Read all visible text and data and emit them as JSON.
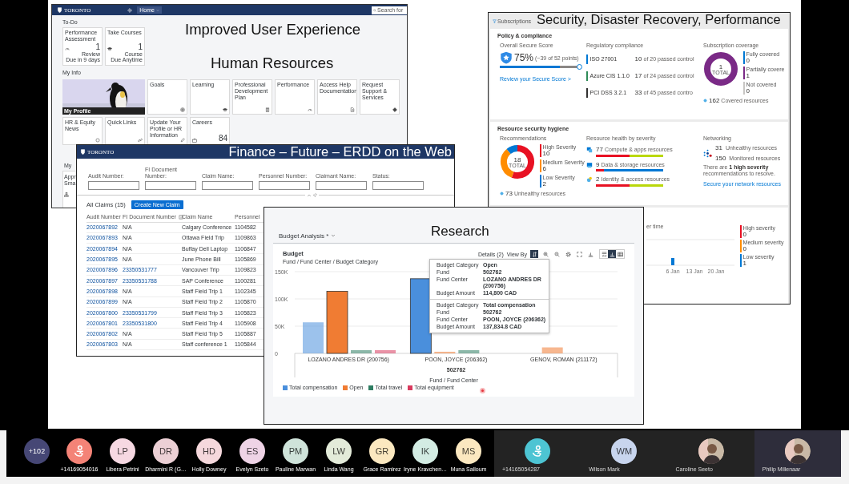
{
  "hr_portal": {
    "logo": "TORONTO",
    "nav": "Home",
    "search_placeholder": "Search for",
    "slide_title": "Improved User Experience",
    "slide_subtitle": "Human Resources",
    "todo_label": "To-Do",
    "todo_tiles": [
      {
        "title": "Performance Assessment",
        "kind": "gauge",
        "count": "1",
        "caption": "Review",
        "subcaption": "Due in 9 days"
      },
      {
        "title": "Take Courses",
        "kind": "cap",
        "count": "1",
        "caption": "Course",
        "subcaption": "Due Anytime"
      }
    ],
    "myinfo_label": "My Info",
    "profile_caption": "My Profile",
    "info_tiles": [
      {
        "title": "Goals",
        "kind": "target"
      },
      {
        "title": "Learning",
        "kind": "cap"
      },
      {
        "title": "Professional Development Plan",
        "kind": "clipboard"
      },
      {
        "title": "Performance",
        "kind": "gauge"
      },
      {
        "title": "Access Help Documentation",
        "kind": "doc"
      },
      {
        "title": "Request Support & Services",
        "kind": "diamond"
      }
    ],
    "row2_tiles": [
      {
        "title": "HR & Equity News",
        "kind": "ring"
      },
      {
        "title": "Quick Links",
        "kind": "link"
      },
      {
        "title": "Update Your Profile or HR Information",
        "kind": "pencil"
      },
      {
        "title": "Careers",
        "kind": "bag",
        "count": "84"
      }
    ],
    "section3_label": "My",
    "section3_tile": "Appr Sma"
  },
  "finance": {
    "logo": "TORONTO",
    "title": "Finance – Future – ERDD on the Web",
    "filters": [
      "Audit Number:",
      "FI Document Number:",
      "Claim Name:",
      "Personnel Number:",
      "Claimant Name:",
      "Status:"
    ],
    "claims_title": "All Claims (15)",
    "create_button": "Create New Claim",
    "columns": [
      {
        "label": "Audit Number",
        "info_icon": false
      },
      {
        "label": "FI Document Number",
        "info_icon": true
      },
      {
        "label": "Claim Name",
        "info_icon": false
      },
      {
        "label": "Personnel",
        "info_icon": false
      }
    ],
    "rows": [
      {
        "audit": "2020067892",
        "fi_doc": "N/A",
        "fi_link": false,
        "claim": "Calgary Conference",
        "personnel": "1104582"
      },
      {
        "audit": "2020067893",
        "fi_doc": "N/A",
        "fi_link": false,
        "claim": "Ottawa Field Trip",
        "personnel": "1109863"
      },
      {
        "audit": "2020067894",
        "fi_doc": "N/A",
        "fi_link": false,
        "claim": "Buffay Dell Laptop",
        "personnel": "1106847"
      },
      {
        "audit": "2020067895",
        "fi_doc": "N/A",
        "fi_link": false,
        "claim": "June Phone Bill",
        "personnel": "1105869"
      },
      {
        "audit": "2020067896",
        "fi_doc": "23350531777",
        "fi_link": true,
        "claim": "Vancouver Trip",
        "personnel": "1109823"
      },
      {
        "audit": "2020067897",
        "fi_doc": "23350531788",
        "fi_link": true,
        "claim": "SAP Conference",
        "personnel": "1100281"
      },
      {
        "audit": "2020067898",
        "fi_doc": "N/A",
        "fi_link": false,
        "claim": "Staff Field Trip 1",
        "personnel": "1102345"
      },
      {
        "audit": "2020067899",
        "fi_doc": "N/A",
        "fi_link": false,
        "claim": "Staff Field Trip 2",
        "personnel": "1105870"
      },
      {
        "audit": "2020067800",
        "fi_doc": "23350531799",
        "fi_link": true,
        "claim": "Staff Field Trip 3",
        "personnel": "1105823"
      },
      {
        "audit": "2020067801",
        "fi_doc": "23350531800",
        "fi_link": true,
        "claim": "Staff Field Trip 4",
        "personnel": "1105908"
      },
      {
        "audit": "2020067802",
        "fi_doc": "N/A",
        "fi_link": false,
        "claim": "Staff Field Trip 5",
        "personnel": "1105887"
      },
      {
        "audit": "2020067803",
        "fi_doc": "N/A",
        "fi_link": false,
        "claim": "Staff conference 1",
        "personnel": "1105844"
      }
    ]
  },
  "research": {
    "slide_title": "Research",
    "view_name": "Budget Analysis *",
    "chart_subtitle": "Fund / Fund Center / Budget Category",
    "details": "Details (2)",
    "view_by": "View By",
    "toolbar": [
      {
        "kind": "sort",
        "selected": true
      },
      {
        "kind": "zoomin",
        "selected": false
      },
      {
        "kind": "zoomout",
        "selected": false
      },
      {
        "kind": "gear",
        "selected": false
      },
      {
        "kind": "fullscreen",
        "selected": false
      },
      {
        "kind": "barchart",
        "selected": false
      }
    ],
    "view_toggle": [
      {
        "kind": "charttable",
        "selected": false
      },
      {
        "kind": "barchart",
        "selected": true
      },
      {
        "kind": "table",
        "selected": false
      }
    ],
    "chart_data": {
      "type": "bar",
      "title": "Budget",
      "xlabel": "Fund / Fund Center",
      "categories": [
        "LOZANO ANDRES DR (200756)",
        "POON, JOYCE (206362)",
        "GENOV, ROMAN (211172)"
      ],
      "series": [
        {
          "name": "Total compensation",
          "color": "#4a8fdc",
          "values": [
            57000,
            137000,
            null
          ]
        },
        {
          "name": "Open",
          "color": "#f07c33",
          "values": [
            114000,
            3000,
            11000
          ]
        },
        {
          "name": "Total travel",
          "color": "#2e7d62",
          "values": [
            6000,
            6000,
            null
          ]
        },
        {
          "name": "Total equipment",
          "color": "#d93a5e",
          "values": [
            6000,
            null,
            null
          ]
        }
      ],
      "ylim": [
        0,
        150000
      ],
      "yticks": [
        0,
        {
          "value": 50000,
          "label": "50K"
        },
        {
          "value": 100000,
          "label": "100K"
        },
        {
          "value": 150000,
          "label": "150K"
        }
      ]
    },
    "bars": [
      {
        "selected": false
      },
      {
        "selected": true
      },
      {
        "selected": true
      },
      {
        "selected": false
      },
      {
        "selected": false
      },
      {
        "selected": false
      },
      {
        "selected": false
      },
      {
        "selected": false
      }
    ],
    "group_label": "502762",
    "tooltip": [
      {
        "rows": [
          {
            "label": "Budget Category",
            "value": "Open"
          },
          {
            "label": "Fund",
            "value": "502762"
          },
          {
            "label": "Fund Center",
            "value": "LOZANO ANDRES DR (200756)"
          },
          {
            "label": "Budget Amount",
            "value": "114,800 CAD"
          }
        ]
      },
      {
        "rows": [
          {
            "label": "Budget Category",
            "value": "Total compensation"
          },
          {
            "label": "Fund",
            "value": "502762"
          },
          {
            "label": "Fund Center",
            "value": "POON, JOYCE (206362)"
          },
          {
            "label": "Budget Amount",
            "value": "137,834.8 CAD"
          }
        ]
      }
    ]
  },
  "security": {
    "slide_title": "Security, Disaster Recovery, Performance",
    "filter_chip": "Subscriptions",
    "policy": {
      "heading": "Policy & compliance",
      "secure_score": {
        "label": "Overall Secure Score",
        "value": "75%",
        "detail": "(~39 of 52 points)",
        "level": 0.75,
        "link": "Review your Secure Score >"
      },
      "compliance": {
        "label": "Regulatory compliance",
        "items": [
          {
            "name": "ISO 27001",
            "count": "10",
            "detail": "of 20 passed control",
            "color": "#0078d4"
          },
          {
            "name": "Azure CIS 1.1.0",
            "count": "17",
            "detail": "of 24 passed control",
            "color": "#2e8b57"
          },
          {
            "name": "PCI DSS 3.2.1",
            "count": "33",
            "detail": "of 45 passed contro",
            "color": "#323130"
          }
        ]
      },
      "coverage": {
        "label": "Subscription coverage",
        "total": "1",
        "total_label": "TOTAL",
        "legend": [
          {
            "label": "Fully covered",
            "value": "0",
            "color": "#0078d4"
          },
          {
            "label": "Partially covere",
            "value": "1",
            "color": "#7a2a86"
          },
          {
            "label": "Not covered",
            "value": "0",
            "color": "#c8c6c4"
          }
        ],
        "resources_count": "162",
        "resources_label": "Covered resources"
      }
    },
    "hygiene": {
      "heading": "Resource security hygiene",
      "recommendations": {
        "label": "Recommendations",
        "total": "18",
        "total_label": "TOTAL",
        "legend": [
          {
            "label": "High Severity",
            "value": "10",
            "color": "#e81123"
          },
          {
            "label": "Medium Severity",
            "value": "6",
            "color": "#ff8c00"
          },
          {
            "label": "Low Severity",
            "value": "2",
            "color": "#0078d4"
          }
        ],
        "unhealthy_count": "73",
        "unhealthy_label": "Unhealthy resources"
      },
      "health": {
        "label": "Resource health by severity",
        "items": [
          {
            "kind": "compute",
            "count": "77",
            "label": "Compute & apps resources",
            "level": 0.5,
            "color": "#bad80a"
          },
          {
            "kind": "data",
            "count": "9",
            "label": "Data & storage resources",
            "level": 0.12,
            "color": "#0078d4"
          },
          {
            "kind": "identity",
            "count": "2",
            "label": "Identity & access resources",
            "level": 0.5,
            "color": "#bad80a"
          }
        ]
      },
      "networking": {
        "label": "Networking",
        "stats": [
          {
            "count": "31",
            "description": "Unhealthy resources"
          },
          {
            "count": "150",
            "description": "Monitored resources"
          }
        ],
        "note": "There are **1 high severity** recommendations to resolve.",
        "link": "Secure your network resources"
      }
    },
    "trend": {
      "title": "er time",
      "ticks": [
        "6 Jan",
        "13 Jan",
        "20 Jan"
      ],
      "legend": [
        {
          "label": "High severity",
          "value": "0",
          "color": "#e81123"
        },
        {
          "label": "Medium severity",
          "value": "0",
          "color": "#ff8c00"
        },
        {
          "label": "Low severity",
          "value": "1",
          "color": "#0078d4"
        }
      ]
    }
  },
  "call_bar": {
    "overflow_count": "+102",
    "participants": [
      {
        "kind": "phone",
        "name": "+14169054016",
        "color": "#f48377"
      },
      {
        "kind": "initials",
        "initials": "LP",
        "name": "Libera Petrini",
        "color": "#f6d8e2"
      },
      {
        "kind": "initials",
        "initials": "DR",
        "name": "Dharmini R (G…",
        "color": "#ecd0d5"
      },
      {
        "kind": "initials",
        "initials": "HD",
        "name": "Holly Downey",
        "color": "#f5d8dc"
      },
      {
        "kind": "initials",
        "initials": "ES",
        "name": "Evelyn Szeto",
        "color": "#eed3e6"
      },
      {
        "kind": "initials",
        "initials": "PM",
        "name": "Pauline Marwan",
        "color": "#cfe3da"
      },
      {
        "kind": "initials",
        "initials": "LW",
        "name": "Linda Wang",
        "color": "#e3ebd9"
      },
      {
        "kind": "initials",
        "initials": "GR",
        "name": "Grace Ramirez",
        "color": "#fbe8c0"
      },
      {
        "kind": "initials",
        "initials": "IK",
        "name": "Iryne Kravchen…",
        "color": "#d3ece3"
      },
      {
        "kind": "initials",
        "initials": "MS",
        "name": "Muna Salloum",
        "color": "#fbe8c0"
      }
    ],
    "tiles": [
      {
        "kind": "phone",
        "name": "+14165054287",
        "color": "#4dc4d3",
        "selected": false
      },
      {
        "kind": "initials",
        "initials": "WM",
        "name": "Wilson Mark",
        "color": "#c8d5ee",
        "selected": false
      },
      {
        "name": "Caroline Seeto",
        "selected": false
      },
      {
        "name": "Philip Millenaar",
        "selected": true
      }
    ]
  }
}
